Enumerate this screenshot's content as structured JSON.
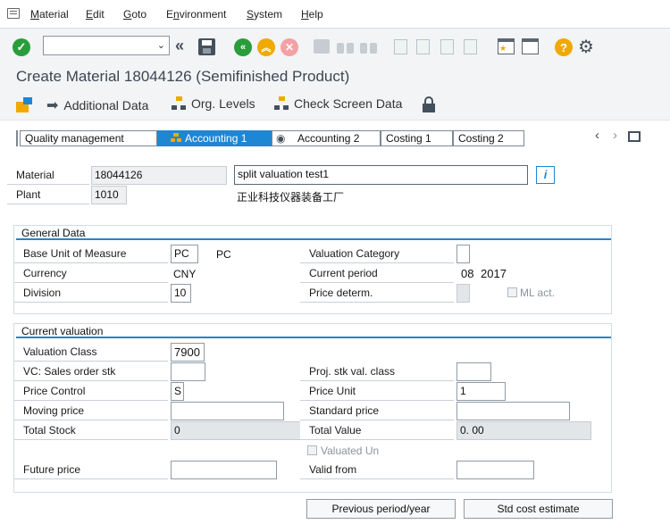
{
  "menubar": {
    "items": [
      {
        "prefix": "",
        "ul": "M",
        "rest": "aterial"
      },
      {
        "prefix": "",
        "ul": "E",
        "rest": "dit"
      },
      {
        "prefix": "",
        "ul": "G",
        "rest": "oto"
      },
      {
        "prefix": "E",
        "ul": "n",
        "rest": "vironment"
      },
      {
        "prefix": "",
        "ul": "S",
        "rest": "ystem"
      },
      {
        "prefix": "",
        "ul": "H",
        "rest": "elp"
      }
    ]
  },
  "toolbar": {
    "command_value": ""
  },
  "title": "Create Material 18044126 (Semifinished Product)",
  "app_toolbar": {
    "additional_data": "Additional Data",
    "org_levels": "Org. Levels",
    "check_screen": "Check Screen Data"
  },
  "tabs": [
    "Quality management",
    "Accounting 1",
    "Accounting 2",
    "Costing 1",
    "Costing 2"
  ],
  "header": {
    "material_label": "Material",
    "material_value": "18044126",
    "description": "split valuation test1",
    "plant_label": "Plant",
    "plant_value": "1010",
    "plant_name": "正业科技仪器装备工厂"
  },
  "general": {
    "title": "General Data",
    "base_uom_label": "Base Unit of Measure",
    "base_uom_value": "PC",
    "base_uom_text": "PC",
    "currency_label": "Currency",
    "currency_value": "CNY",
    "division_label": "Division",
    "division_value": "10",
    "valcat_label": "Valuation Category",
    "period_label": "Current period",
    "period_value": "08",
    "period_year": "2017",
    "pricedet_label": "Price determ.",
    "mlact_label": "ML act."
  },
  "valuation": {
    "title": "Current valuation",
    "vclass_label": "Valuation Class",
    "vclass_value": "7900",
    "vcsales_label": "VC: Sales order stk",
    "projstk_label": "Proj. stk val. class",
    "pricectrl_label": "Price Control",
    "pricectrl_value": "S",
    "priceunit_label": "Price Unit",
    "priceunit_value": "1",
    "moving_label": "Moving price",
    "standard_label": "Standard price",
    "totalstock_label": "Total Stock",
    "totalstock_value": "0",
    "totalvalue_label": "Total Value",
    "totalvalue_value": "0. 00",
    "valuated_label": "Valuated Un",
    "future_label": "Future price",
    "validfrom_label": "Valid from"
  },
  "buttons": {
    "prev_period": "Previous period/year",
    "std_cost": "Std cost estimate"
  },
  "colors": {
    "accent": "#1f86d4",
    "green": "#2a9d3b",
    "orange": "#f0a900",
    "red": "#e8484f"
  }
}
